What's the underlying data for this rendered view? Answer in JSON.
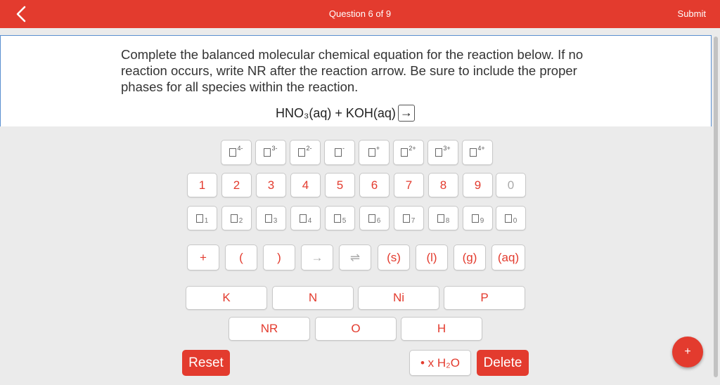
{
  "header": {
    "title": "Question 6 of 9",
    "submit_label": "Submit"
  },
  "question": {
    "instruction": "Complete the balanced molecular chemical equation for the reaction below. If no reaction occurs, write NR after the reaction arrow. Be sure to include the proper phases for all species within the reaction.",
    "equation_prefix": "HNO₃(aq) + KOH(aq)",
    "arrow": "→"
  },
  "keypad": {
    "charges": [
      "4-",
      "3-",
      "2-",
      "-",
      "+",
      "2+",
      "3+",
      "4+"
    ],
    "digits": [
      "1",
      "2",
      "3",
      "4",
      "5",
      "6",
      "7",
      "8",
      "9",
      "0"
    ],
    "subscripts": [
      "1",
      "2",
      "3",
      "4",
      "5",
      "6",
      "7",
      "8",
      "9",
      "0"
    ],
    "symbols": {
      "plus": "+",
      "open_paren": "(",
      "close_paren": ")",
      "arrow": "→",
      "equilibrium": "⇌",
      "solid": "(s)",
      "liquid": "(l)",
      "gas": "(g)",
      "aqueous": "(aq)"
    },
    "elements_row1": [
      "K",
      "N",
      "Ni",
      "P"
    ],
    "elements_row2": [
      "NR",
      "O",
      "H"
    ],
    "reset_label": "Reset",
    "hydrate_label": "• x H₂O",
    "delete_label": "Delete"
  },
  "fab_label": "+",
  "colors": {
    "accent": "#e33b2e",
    "panel_border": "#5a8fd0"
  },
  "icons": {
    "back": "chevron-left-icon"
  }
}
